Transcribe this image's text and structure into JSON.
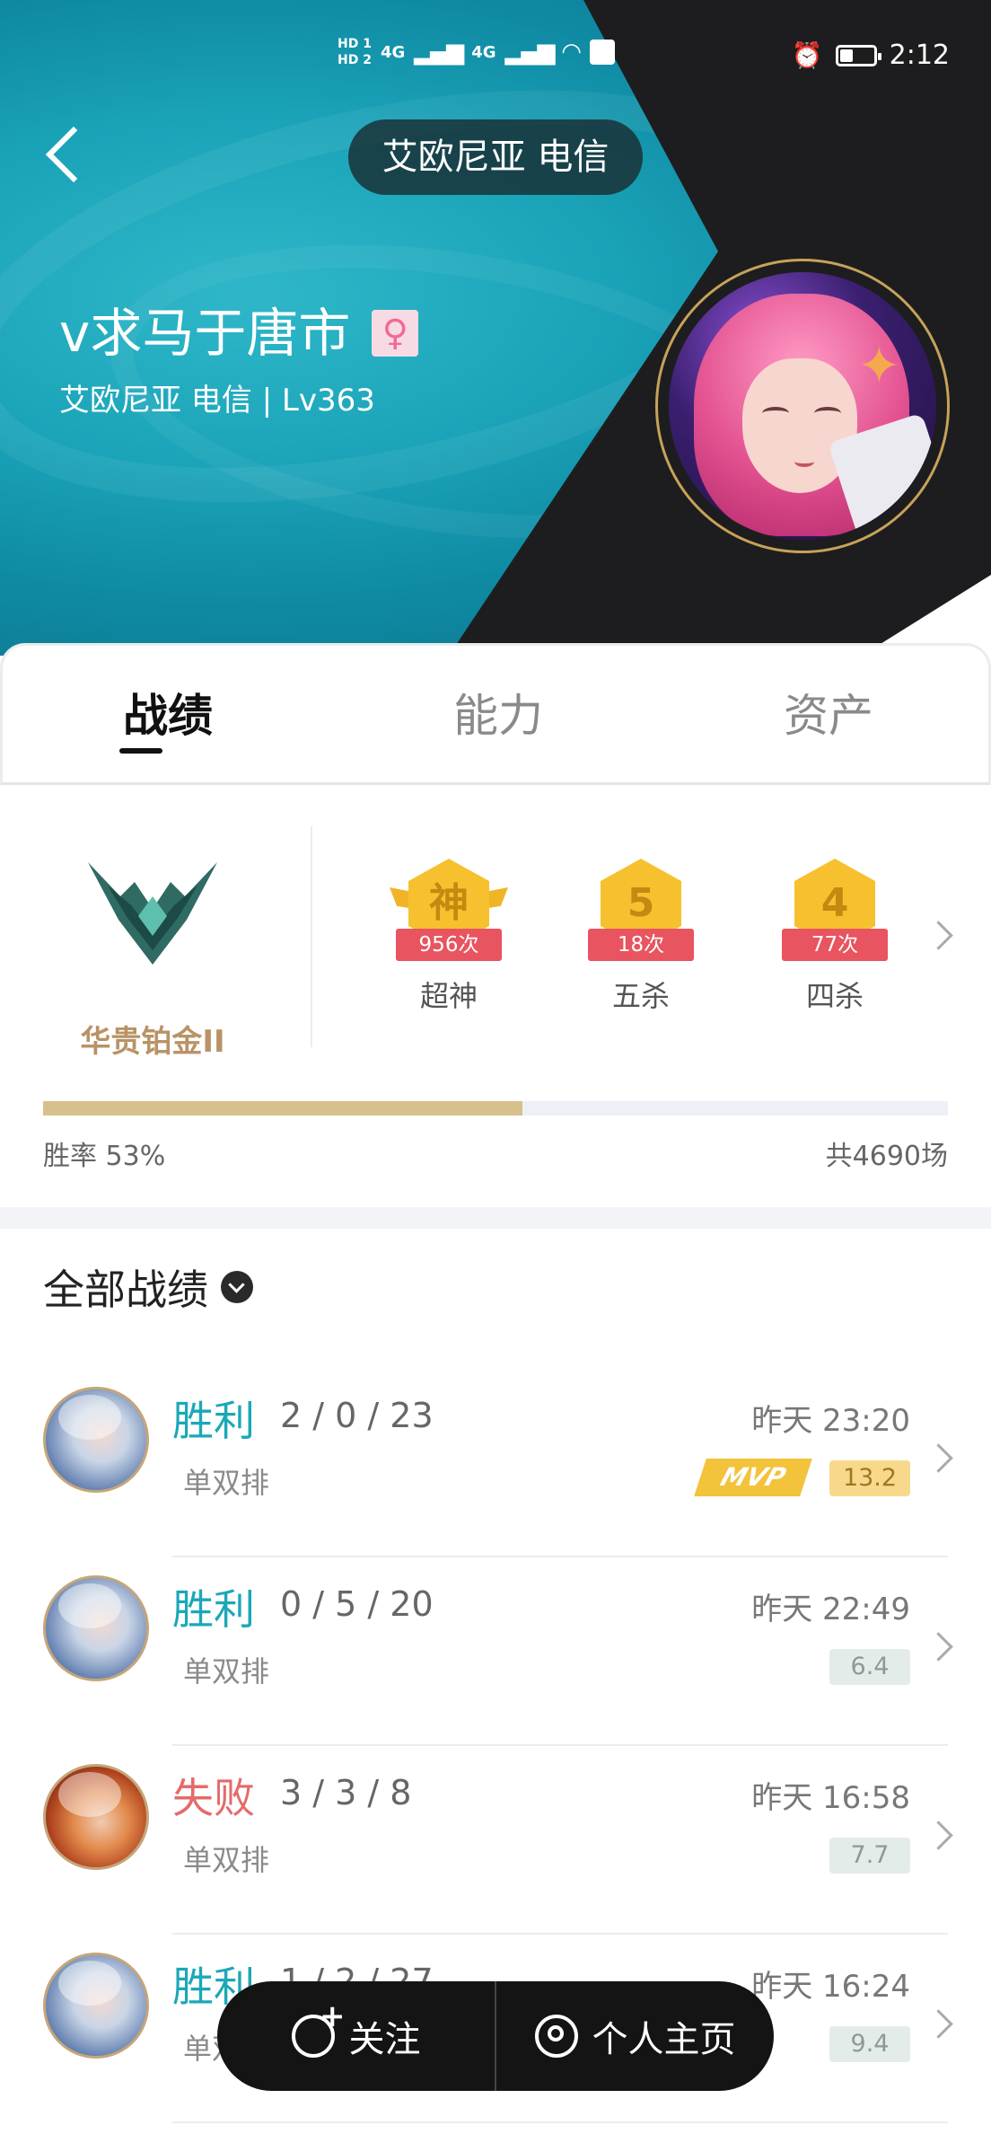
{
  "status_bar": {
    "hd1": "HD 1",
    "hd2": "HD 2",
    "net1": "4G",
    "net2": "4G",
    "time": "2:12"
  },
  "header": {
    "server": "艾欧尼亚 电信",
    "nickname": "v求马于唐市",
    "gender_symbol": "♀",
    "subtitle": "艾欧尼亚 电信 | Lv363"
  },
  "tabs": [
    {
      "label": "战绩",
      "active": true
    },
    {
      "label": "能力",
      "active": false
    },
    {
      "label": "资产",
      "active": false
    }
  ],
  "rank": {
    "name": "华贵铂金II"
  },
  "badges": [
    {
      "glyph": "神",
      "count": "956次",
      "label": "超神"
    },
    {
      "glyph": "5",
      "count": "18次",
      "label": "五杀"
    },
    {
      "glyph": "4",
      "count": "77次",
      "label": "四杀"
    }
  ],
  "stats": {
    "win_rate_label": "胜率  53%",
    "win_rate_value": 0.53,
    "total_games": "共4690场"
  },
  "matches_filter": "全部战绩",
  "matches": [
    {
      "result": "胜利",
      "outcome": "win",
      "kda": "2 / 0 / 23",
      "mode": "单双排",
      "time": "昨天 23:20",
      "score": "13.2",
      "mvp": true,
      "hero_color": "blue"
    },
    {
      "result": "胜利",
      "outcome": "win",
      "kda": "0 / 5 / 20",
      "mode": "单双排",
      "time": "昨天 22:49",
      "score": "6.4",
      "mvp": false,
      "hero_color": "blue"
    },
    {
      "result": "失败",
      "outcome": "loss",
      "kda": "3 / 3 / 8",
      "mode": "单双排",
      "time": "昨天 16:58",
      "score": "7.7",
      "mvp": false,
      "hero_color": "red"
    },
    {
      "result": "胜利",
      "outcome": "win",
      "kda": "1 / 2 / 27",
      "mode": "单双排",
      "time": "昨天 16:24",
      "score": "9.4",
      "mvp": false,
      "hero_color": "blue"
    }
  ],
  "mvp_label": "MVP",
  "floating_bar": {
    "follow_label": "关注",
    "home_label": "个人主页"
  },
  "colors": {
    "win": "#1aa8b8",
    "loss": "#e56a6a",
    "rank_gold": "#b89366",
    "win_bar": "#d7c08b"
  }
}
